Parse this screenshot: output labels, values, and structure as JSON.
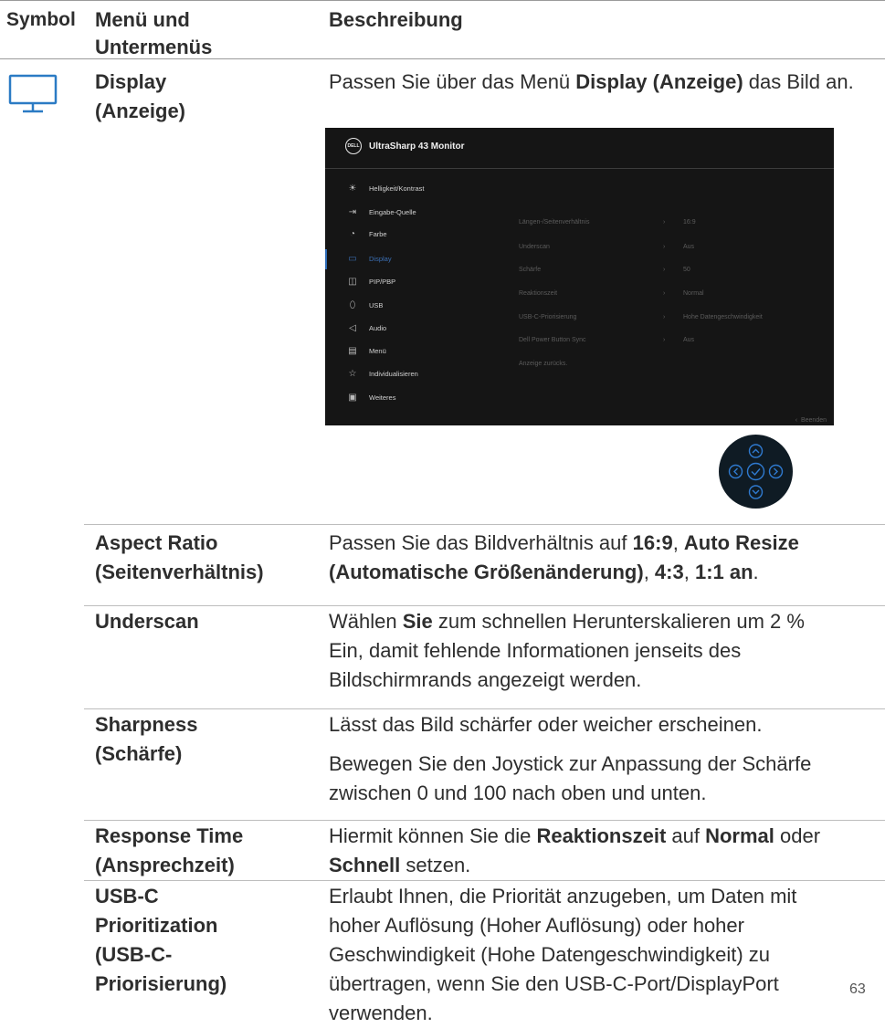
{
  "headers": {
    "symbol": "Symbol",
    "menu": "Menü und Untermenüs",
    "description": "Beschreibung"
  },
  "display_row": {
    "icon": "monitor-icon",
    "name": "Display (Anzeige)",
    "desc_pre": "Passen Sie über das Menü ",
    "desc_bold": "Display (Anzeige)",
    "desc_post": " das Bild an."
  },
  "osd": {
    "logo": "DELL",
    "title": "UltraSharp 43 Monitor",
    "menu": [
      {
        "icon": "brightness-icon",
        "label": "Helligkeit/Kontrast"
      },
      {
        "icon": "input-source-icon",
        "label": "Eingabe-Quelle"
      },
      {
        "icon": "color-palette-icon",
        "label": "Farbe"
      },
      {
        "icon": "display-icon",
        "label": "Display"
      },
      {
        "icon": "pip-pbp-icon",
        "label": "PIP/PBP"
      },
      {
        "icon": "usb-mouse-icon",
        "label": "USB"
      },
      {
        "icon": "speaker-icon",
        "label": "Audio"
      },
      {
        "icon": "menu-icon",
        "label": "Menü"
      },
      {
        "icon": "star-icon",
        "label": "Individualisieren"
      },
      {
        "icon": "others-icon",
        "label": "Weiteres"
      }
    ],
    "settings": [
      {
        "label": "Längen-/Seitenverhältnis",
        "value": "16:9"
      },
      {
        "label": "Underscan",
        "value": "Aus"
      },
      {
        "label": "Schärfe",
        "value": "50"
      },
      {
        "label": "Reaktionszeit",
        "value": "Normal"
      },
      {
        "label": "USB-C-Priorisierung",
        "value": "Hohe Datengeschwindigkeit"
      },
      {
        "label": "Dell Power Button Sync",
        "value": "Aus"
      },
      {
        "label": "Anzeige zurücks.",
        "value": ""
      }
    ],
    "exit": "Beenden",
    "arrow": "›",
    "exit_arrow": "‹"
  },
  "joystick": {
    "icons": [
      "joystick-up-icon",
      "joystick-left-icon",
      "joystick-ok-icon",
      "joystick-right-icon",
      "joystick-down-icon"
    ]
  },
  "rows": {
    "aspect": {
      "name": "Aspect Ratio (Seitenverhältnis)",
      "d1": "Passen Sie das Bildverhältnis auf ",
      "b1": "16:9",
      "d2": ", ",
      "b2": "Auto Resize (Automatische Größenänderung)",
      "d3": ", ",
      "b3": "4:3",
      "d4": ", ",
      "b4": "1:1 an",
      "d5": "."
    },
    "underscan": {
      "name": "Underscan",
      "d1": "Wählen ",
      "b1": "Sie",
      "d2": " zum schnellen Herunterskalieren um 2 % Ein, damit fehlende Informationen jenseits des Bildschirmrands angezeigt werden."
    },
    "sharpness": {
      "name": "Sharpness (Schärfe)",
      "p1": "Lässt das Bild schärfer oder weicher erscheinen.",
      "p2": "Bewegen Sie den Joystick zur Anpassung der Schärfe zwischen 0 und 100 nach oben und unten."
    },
    "response": {
      "name": "Response Time (Ansprechzeit)",
      "d1": "Hiermit können Sie die ",
      "b1": "Reaktionszeit",
      "d2": " auf ",
      "b2": "Normal",
      "d3": " oder ",
      "b3": "Schnell",
      "d4": " setzen."
    },
    "usbc": {
      "name": "USB-C Prioritization (USB-C-Priorisierung)",
      "desc": "Erlaubt Ihnen, die Priorität anzugeben, um Daten mit hoher Auflösung (Hoher Auflösung) oder hoher Geschwindigkeit (Hohe Datengeschwindigkeit) zu übertragen, wenn Sie den USB-C-Port/DisplayPort verwenden."
    }
  },
  "page_number": "63"
}
